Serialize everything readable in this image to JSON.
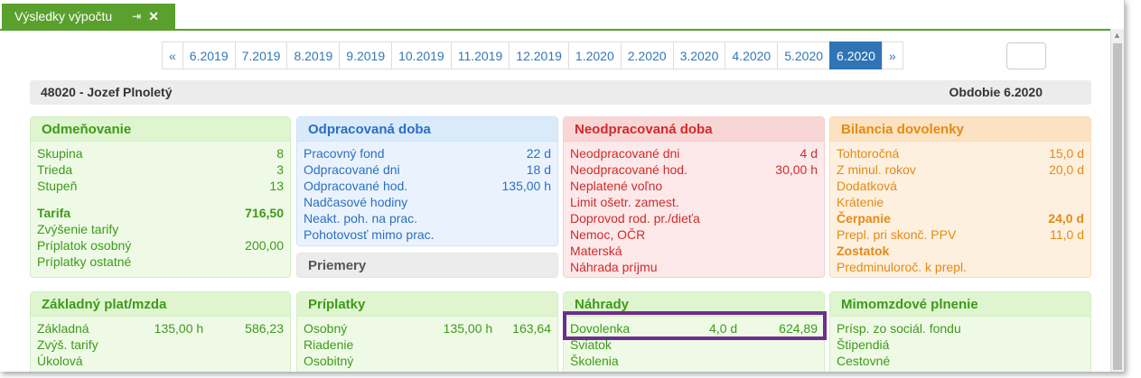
{
  "tab": {
    "title": "Výsledky výpočtu",
    "pin_icon": "⇥",
    "close_icon": "✕"
  },
  "pager": {
    "prev": "«",
    "next": "»",
    "months": [
      "6.2019",
      "7.2019",
      "8.2019",
      "9.2019",
      "10.2019",
      "11.2019",
      "12.2019",
      "1.2020",
      "2.2020",
      "3.2020",
      "4.2020",
      "5.2020",
      "6.2020"
    ],
    "active": "6.2020"
  },
  "settings_button": {
    "icon": ""
  },
  "employee": {
    "label": "48020 - Jozef Plnoletý",
    "period": "Obdobie 6.2020",
    "icon": "",
    "toggle_icon": ""
  },
  "odmenovanie": {
    "title": "Odmeňovanie",
    "icon": "",
    "toggle": "",
    "skupina_label": "Skupina",
    "skupina_value": "8",
    "trieda_label": "Trieda",
    "trieda_value": "3",
    "stupen_label": "Stupeň",
    "stupen_value": "13",
    "tarifa_label": "Tarifa",
    "tarifa_value": "716,50",
    "zvysenie_label": "Zvýšenie tarify",
    "priplatok_label": "Príplatok osobný",
    "priplatok_value": "200,00",
    "priplatky_label": "Príplatky ostatné"
  },
  "odpracovana": {
    "title": "Odpracovaná doba",
    "icon": "",
    "toggle": "",
    "fond_label": "Pracovný fond",
    "fond_value": "22 d",
    "dni_label": "Odpracované dni",
    "dni_value": "18 d",
    "hod_label": "Odpracované hod.",
    "hod_value": "135,00 h",
    "nadcas_label": "Nadčasové hodiny",
    "neakt_label": "Neakt. poh. na prac.",
    "pohot_label": "Pohotovosť mimo prac."
  },
  "priemery": {
    "title": "Priemery",
    "icon": "",
    "toggle": ""
  },
  "neodpracovana": {
    "title": "Neodpracovaná doba",
    "icon": "",
    "toggle": "",
    "dni_label": "Neodpracované dni",
    "dni_value": "4 d",
    "hod_label": "Neodpracované hod.",
    "hod_value": "30,00 h",
    "neplatene_label": "Neplatené voľno",
    "limit_label": "Limit ošetr. zamest.",
    "doprovod_label": "Doprovod rod. pr./dieťa",
    "nemoc_label": "Nemoc, OČR",
    "materska_label": "Materská",
    "nahrada_label": "Náhrada príjmu"
  },
  "bilancia": {
    "title": "Bilancia dovolenky",
    "icon": "",
    "toggle": "",
    "tohtorocna_label": "Tohtoročná",
    "tohtorocna_value": "15,0 d",
    "zminul_label": "Z minul. rokov",
    "zminul_value": "20,0 d",
    "dodatkova_label": "Dodatková",
    "kratenie_label": "Krátenie",
    "cerpanie_label": "Čerpanie",
    "cerpanie_value": "24,0 d",
    "prepl_label": "Prepl. pri skonč. PPV",
    "prepl_value": "11,0 d",
    "zostatok_label": "Zostatok",
    "predminul_label": "Predminuloroč. k prepl."
  },
  "zakladny": {
    "title": "Základný plat/mzda",
    "icon": "",
    "toggle": "",
    "zakladna_label": "Základná",
    "zakladna_hours": "135,00 h",
    "zakladna_value": "586,23",
    "zvys_label": "Zvýš. tarify",
    "ukolova_label": "Úkolová"
  },
  "priplatky": {
    "title": "Príplatky",
    "icon": "",
    "toggle": "",
    "osobny_label": "Osobný",
    "osobny_hours": "135,00 h",
    "osobny_value": "163,64",
    "riadenie_label": "Riadenie",
    "osobitny_label": "Osobitný"
  },
  "nahrady": {
    "title": "Náhrady",
    "icon": "",
    "toggle": "",
    "dovolenka_label": "Dovolenka",
    "dovolenka_days": "4,0 d",
    "dovolenka_value": "624,89",
    "sviatok_label": "Sviatok",
    "skolenia_label": "Školenia"
  },
  "mimomzdove": {
    "title": "Mimomzdové plnenie",
    "icon": "",
    "toggle": "",
    "prisp_label": "Prísp. zo sociál. fondu",
    "stipendia_label": "Štipendiá",
    "cestovne_label": "Cestovné"
  },
  "colors": {
    "accent_green": "#5aa02c",
    "pager_active": "#2f74b5",
    "highlight": "#6c2f8e"
  }
}
